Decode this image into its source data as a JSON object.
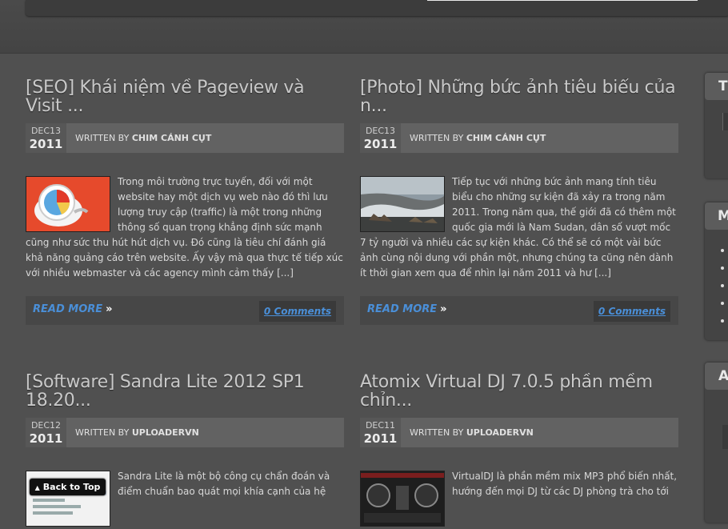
{
  "posts": [
    {
      "title": "[SEO] Khái niệm về Pageview và Visit ...",
      "date_md": "DEC13",
      "date_year": "2011",
      "written_prefix": "WRITTEN BY",
      "author": "CHIM CÁNH CỤT",
      "excerpt": "Trong môi trường trực tuyến, đối với một website hay một dịch vụ web nào đó thì lưu lượng truy cập (traffic) là một trong những thông số quan trọng khẳng định sức mạnh cũng như sức thu hút hút dịch vụ. Đó cũng là tiêu chí đánh giá khả năng quảng cáo trên website. Ấy vậy mà qua thực tế tiếp xúc với nhiều webmaster và các agency mình cảm thấy [...]",
      "read_more": "READ MORE",
      "comments": "0 Comments"
    },
    {
      "title": "[Photo] Những bức ảnh tiêu biểu của n...",
      "date_md": "DEC13",
      "date_year": "2011",
      "written_prefix": "WRITTEN BY",
      "author": "CHIM CÁNH CỤT",
      "excerpt": "Tiếp tục với những bức ảnh mang tính tiêu biểu cho những sự kiện đã xảy ra trong năm 2011. Trong năm qua, thế giới đã có thêm một quốc gia mới là Nam Sudan, dân số vượt mốc 7 tỷ người và nhiều các sự kiện khác. Có thể sẽ có một vài bức ảnh cùng nội dung với phần một, nhưng chúng ta cũng nên dành ít thời gian xem qua để nhìn lại năm 2011 và hư [...]",
      "read_more": "READ MORE",
      "comments": "0 Comments"
    },
    {
      "title": "[Software] Sandra Lite 2012 SP1 18.20...",
      "date_md": "DEC12",
      "date_year": "2011",
      "written_prefix": "WRITTEN BY",
      "author": "UPLOADERVN",
      "excerpt": "Sandra Lite là một bộ công cụ chẩn đoán và điểm chuẩn bao quát mọi khía cạnh của hệ"
    },
    {
      "title": "Atomix Virtual DJ 7.0.5 phần mềm chỉn...",
      "date_md": "DEC11",
      "date_year": "2011",
      "written_prefix": "WRITTEN BY",
      "author": "UPLOADERVN",
      "excerpt": "VirtualDJ là phần mềm mix MP3 phổ biến nhất, hướng đến mọi DJ từ các DJ phòng trà cho tới"
    }
  ],
  "sidebar": {
    "widget_1_heading": "Tl",
    "widget_2_heading": "M",
    "widget_3_heading": "A"
  },
  "back_to_top": "Back to Top",
  "icons": {
    "read_more_arrow": "»",
    "back_to_top_arrow": "▲"
  },
  "colors": {
    "link": "#4a8fd8",
    "background": "#505050"
  }
}
